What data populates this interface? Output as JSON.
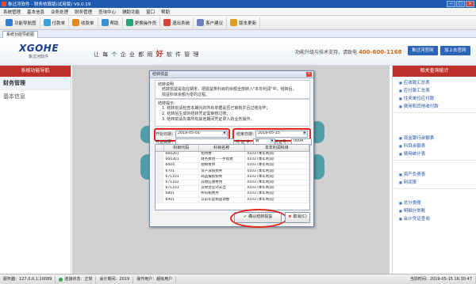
{
  "window": {
    "title": "象过河软件 - 财务核算版(试用版) V9.0.19",
    "buttons": [
      "─",
      "□",
      "×"
    ]
  },
  "menu": [
    "系统管理",
    "基本信息",
    "业务处理",
    "财务管理",
    "查询中心",
    "辅助功能",
    "窗口",
    "帮助"
  ],
  "toolbar": [
    {
      "label": "功能导航图",
      "color": "#2f7dd1"
    },
    {
      "label": "付款单",
      "color": "#3aa0d8"
    },
    {
      "label": "收款单",
      "color": "#e08a1e"
    },
    {
      "label": "帮助",
      "color": "#3f8fd6"
    },
    {
      "label": "更换操作员",
      "color": "#27a37a"
    },
    {
      "label": "退出系统",
      "color": "#d64236"
    },
    {
      "label": "客户建议",
      "color": "#6f7fbd"
    },
    {
      "label": "版本更新",
      "color": "#d8a21e"
    }
  ],
  "tabs": [
    {
      "label": "系统功能导航图"
    }
  ],
  "banner": {
    "logo": "XGOHE",
    "logo_sub": "象过河软件",
    "slogan_a": "让 每 个 企 业 都 用",
    "slogan_hl": "好",
    "slogan_b": "软 件 管 理",
    "hotline_label": "功能升级与技术支持，请致电",
    "hotline": "400-600-1168",
    "btn_official": "象过河官网",
    "btn_forum": "加上去官网"
  },
  "left_panel": {
    "header": "系统功能导航",
    "items": [
      "财务管理",
      "基本信息"
    ]
  },
  "right_panel": {
    "header": "相关查询统计",
    "groups": [
      [
        "应收款汇总表",
        "应付款汇总表",
        "往来单位应付款",
        "费用和其他收付款"
      ],
      [
        "现金银行余额表",
        "科目余额表",
        "费用统计表"
      ],
      [
        "资产负债表",
        "利润表"
      ],
      [
        "总分类账",
        "明细分类账",
        "会计凭证查询"
      ]
    ]
  },
  "dialog": {
    "title": "结转损益",
    "close": "×",
    "section1": {
      "caption": "结转说明",
      "text": [
        "结转损益是指在期末，把损益类科目的余额全部转入\"本年利润\"中，结转后，",
        "损益科目余额为零的过程。"
      ]
    },
    "section2": {
      "caption": "结转提示：",
      "lines": [
        "1. 结转前请检查本期内的所有单据是否已审核并且过账完毕；",
        "2. 结转后生成的结转凭证需审核过账；",
        "3. 结转前请先做所有其他期间凭证录入的业务操作。"
      ]
    },
    "start_date_label": "开始日期：",
    "start_date": "2019-05-01",
    "end_date_label": "结束日期：",
    "end_date": "2019-05-15",
    "voucher_summary_label": "凭证摘要：",
    "voucher_summary": "",
    "voucher_word_label": "凭 证 字：",
    "voucher_word": "转",
    "voucher_no_label": "凭证号：",
    "voucher_no": "0004",
    "table": {
      "headers": [
        "",
        "科目代码",
        "科目名称",
        "本年利润科目"
      ],
      "rows": [
        [
          "",
          "660201",
          "招待费",
          "4103 (本年利润)"
        ],
        [
          "",
          "660301",
          "财务费用－－手续费",
          "4103 (本年利润)"
        ],
        [
          "",
          "6604",
          "勘探费用",
          "4103 (本年利润)"
        ],
        [
          "",
          "6701",
          "资产减值损失",
          "4103 (本年利润)"
        ],
        [
          "",
          "671101",
          "商品报损损失",
          "4103 (本年利润)"
        ],
        [
          "",
          "671102",
          "其他应收费用",
          "4103 (本年利润)"
        ],
        [
          "",
          "671103",
          "其他营业外支出",
          "4103 (本年利润)"
        ],
        [
          "",
          "6801",
          "所得税费用",
          "4103 (本年利润)"
        ],
        [
          "",
          "6901",
          "以前年度损益调整",
          "4103 (本年利润)"
        ]
      ]
    },
    "ok": "确认结转损益",
    "cancel": "取消(C)"
  },
  "status": [
    {
      "label": "服务器：127.0.0.1:10089"
    },
    {
      "label": "连接状态：正常",
      "dot": true
    },
    {
      "label": "会计期间：2019"
    },
    {
      "label": "操作用户：超级用户"
    },
    {
      "label": "当前时间：2019-05-15  16:30:47"
    }
  ]
}
